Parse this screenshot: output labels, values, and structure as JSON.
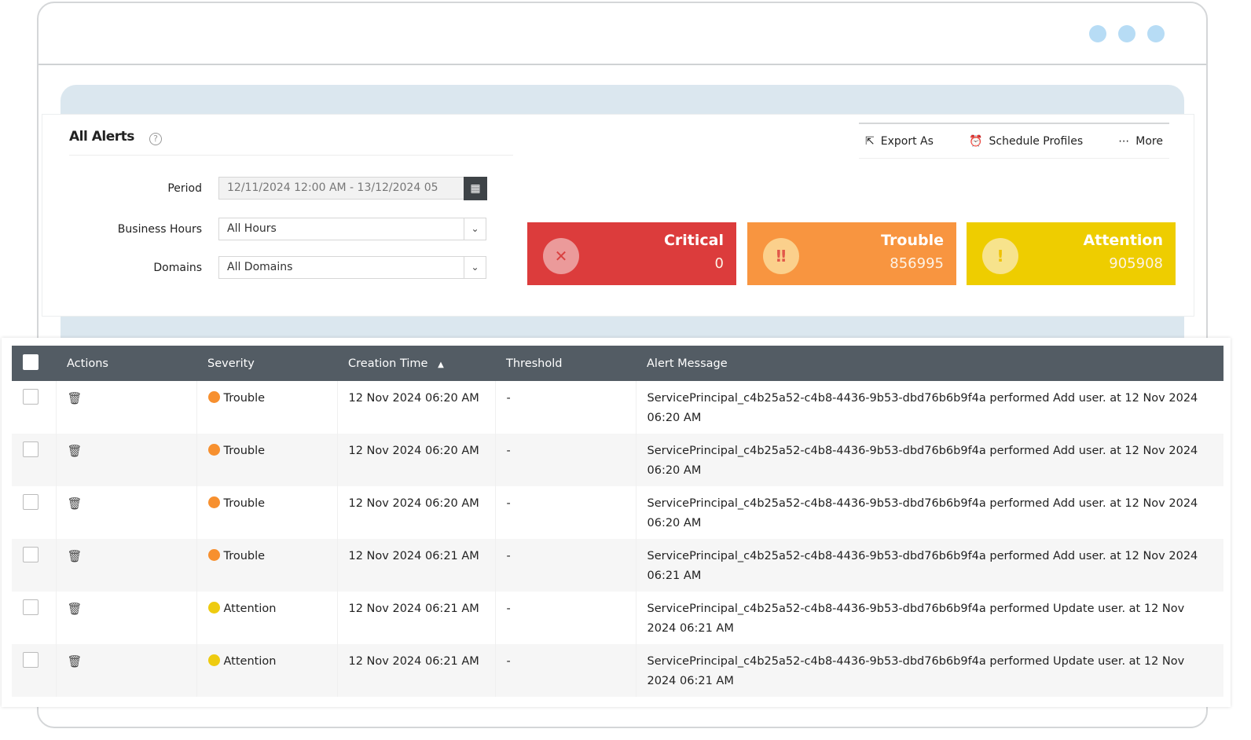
{
  "panel": {
    "title": "All Alerts",
    "help": "?"
  },
  "filters": {
    "period_label": "Period",
    "period_value": "12/11/2024 12:00 AM - 13/12/2024 05",
    "business_hours_label": "Business Hours",
    "business_hours_value": "All Hours",
    "domains_label": "Domains",
    "domains_value": "All Domains"
  },
  "toolbar": {
    "export": "Export As",
    "schedule": "Schedule Profiles",
    "more": "More"
  },
  "cards": [
    {
      "name": "Critical",
      "count": "0",
      "color": "#dc3c3c"
    },
    {
      "name": "Trouble",
      "count": "856995",
      "color": "#f89540"
    },
    {
      "name": "Attention",
      "count": "905908",
      "color": "#eecd00"
    }
  ],
  "table": {
    "headers": [
      "Actions",
      "Severity",
      "Creation Time",
      "Threshold",
      "Alert Message"
    ],
    "rows": [
      {
        "severity": "Trouble",
        "time": "12 Nov 2024 06:20 AM",
        "threshold": "-",
        "message": "ServicePrincipal_c4b25a52-c4b8-4436-9b53-dbd76b6b9f4a performed Add user. at 12 Nov 2024 06:20 AM"
      },
      {
        "severity": "Trouble",
        "time": "12 Nov 2024 06:20 AM",
        "threshold": "-",
        "message": "ServicePrincipal_c4b25a52-c4b8-4436-9b53-dbd76b6b9f4a performed Add user. at 12 Nov 2024 06:20 AM"
      },
      {
        "severity": "Trouble",
        "time": "12 Nov 2024 06:20 AM",
        "threshold": "-",
        "message": "ServicePrincipal_c4b25a52-c4b8-4436-9b53-dbd76b6b9f4a performed Add user. at 12 Nov 2024 06:20 AM"
      },
      {
        "severity": "Trouble",
        "time": "12 Nov 2024 06:21 AM",
        "threshold": "-",
        "message": "ServicePrincipal_c4b25a52-c4b8-4436-9b53-dbd76b6b9f4a performed Add user. at 12 Nov 2024 06:21 AM"
      },
      {
        "severity": "Attention",
        "time": "12 Nov 2024 06:21 AM",
        "threshold": "-",
        "message": "ServicePrincipal_c4b25a52-c4b8-4436-9b53-dbd76b6b9f4a performed Update user. at 12 Nov 2024 06:21 AM"
      },
      {
        "severity": "Attention",
        "time": "12 Nov 2024 06:21 AM",
        "threshold": "-",
        "message": "ServicePrincipal_c4b25a52-c4b8-4436-9b53-dbd76b6b9f4a performed Update user. at 12 Nov 2024 06:21 AM"
      }
    ]
  },
  "severity_colors": {
    "Trouble": "#f7902f",
    "Attention": "#eecb10"
  }
}
